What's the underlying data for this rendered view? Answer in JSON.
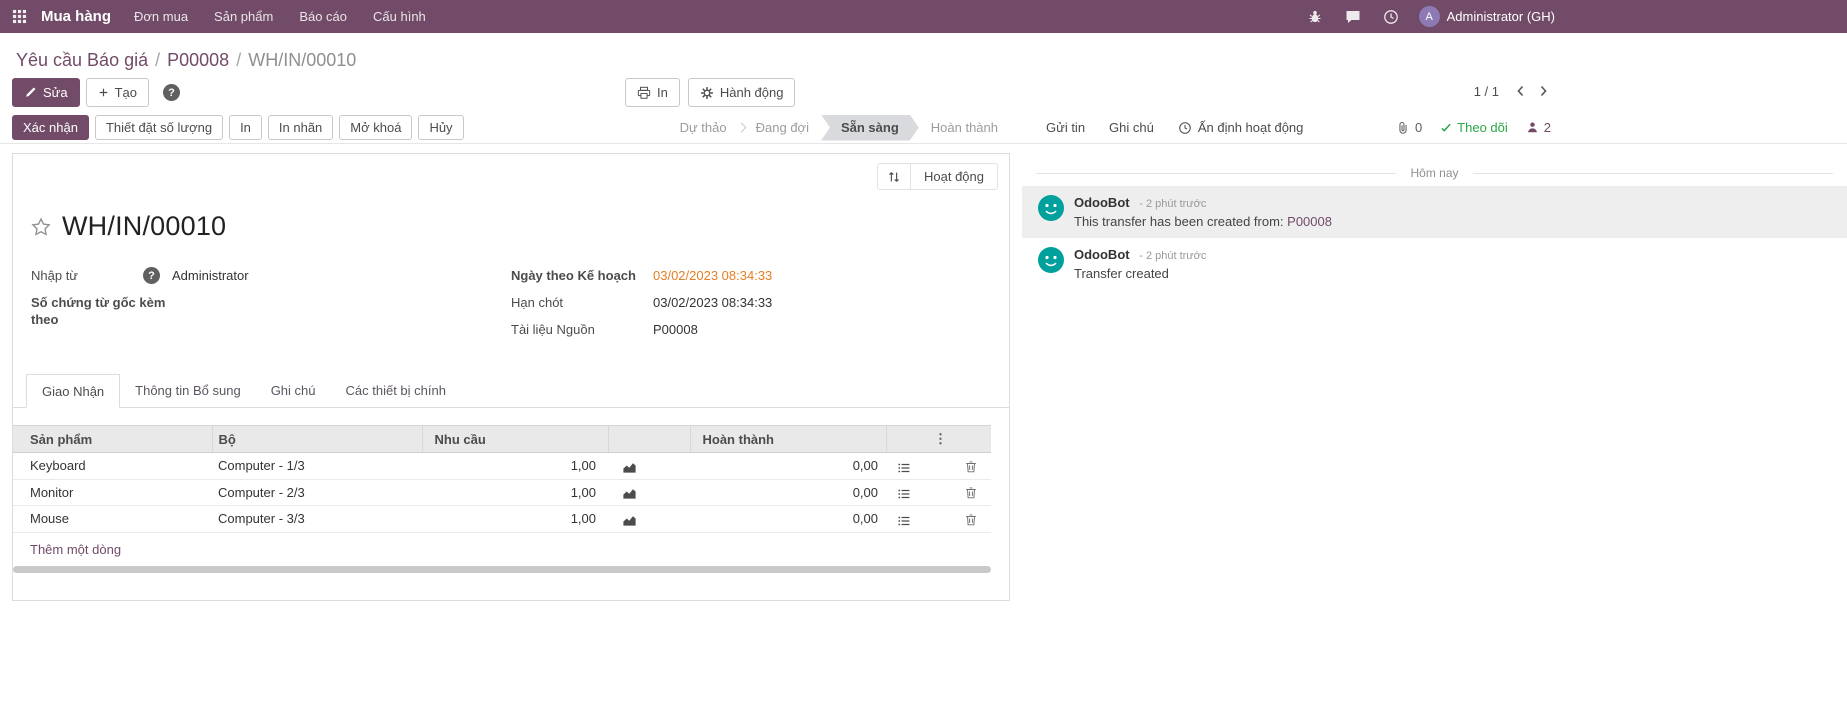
{
  "navbar": {
    "app_name": "Mua hàng",
    "menus": [
      "Đơn mua",
      "Sản phẩm",
      "Báo cáo",
      "Cấu hình"
    ],
    "user": "Administrator (GH)",
    "avatar_initial": "A"
  },
  "breadcrumb": {
    "items": [
      "Yêu cầu Báo giá",
      "P00008"
    ],
    "current": "WH/IN/00010",
    "separator": "/"
  },
  "control_panel": {
    "edit": "Sửa",
    "create": "Tạo",
    "print": "In",
    "action": "Hành động",
    "pager": "1 / 1"
  },
  "statusbar": {
    "buttons": [
      "Xác nhận",
      "Thiết đặt số lượng",
      "In",
      "In nhãn",
      "Mở khoá",
      "Hủy"
    ],
    "steps": [
      {
        "label": "Dự thảo",
        "active": false
      },
      {
        "label": "Đang đợi",
        "active": false
      },
      {
        "label": "Sẵn sàng",
        "active": true
      },
      {
        "label": "Hoàn thành",
        "active": false
      }
    ]
  },
  "sheet": {
    "activity_button": "Hoạt động",
    "title": "WH/IN/00010",
    "fields": {
      "left": [
        {
          "label": "Nhập từ",
          "value": "Administrator"
        },
        {
          "label": "Số chứng từ gốc kèm theo",
          "value": ""
        }
      ],
      "right": [
        {
          "label": "Ngày theo Kế hoạch",
          "value": "03/02/2023 08:34:33"
        },
        {
          "label": "Hạn chót",
          "value": "03/02/2023 08:34:33"
        },
        {
          "label": "Tài liệu Nguồn",
          "value": "P00008"
        }
      ]
    },
    "tabs": [
      "Giao Nhận",
      "Thông tin Bổ sung",
      "Ghi chú",
      "Các thiết bị chính"
    ],
    "active_tab": "Giao Nhận",
    "table": {
      "headers": [
        "Sản phẩm",
        "Bộ",
        "Nhu cầu",
        "Hoàn thành"
      ],
      "rows": [
        {
          "product": "Keyboard",
          "set": "Computer - 1/3",
          "demand": "1,00",
          "done": "0,00"
        },
        {
          "product": "Monitor",
          "set": "Computer - 2/3",
          "demand": "1,00",
          "done": "0,00"
        },
        {
          "product": "Mouse",
          "set": "Computer - 3/3",
          "demand": "1,00",
          "done": "0,00"
        }
      ],
      "add_line": "Thêm một dòng"
    }
  },
  "chatter": {
    "buttons": [
      "Gửi tin",
      "Ghi chú",
      "Ấn định hoạt động"
    ],
    "attachments_count": "0",
    "follow": "Theo dõi",
    "followers_count": "2",
    "day_divider": "Hôm nay",
    "messages": [
      {
        "author": "OdooBot",
        "time": "- 2 phút trước",
        "body_prefix": "This transfer has been created from: ",
        "body_link": "P00008"
      },
      {
        "author": "OdooBot",
        "time": "- 2 phút trước",
        "body_prefix": "Transfer created",
        "body_link": ""
      }
    ]
  },
  "icons": {
    "apps-menu-icon": "▦",
    "bug-icon": "bug",
    "chat-bubble-icon": "speech-bubble",
    "clock-icon": "clock",
    "pencil-icon": "pencil",
    "plus-icon": "+",
    "help-icon": "?",
    "printer-icon": "printer",
    "gear-icon": "gear",
    "chevron-left-icon": "‹",
    "chevron-right-icon": "›",
    "sort-icon": "⇅",
    "star-icon": "☆",
    "paperclip-icon": "paperclip",
    "check-icon": "✓",
    "person-icon": "person",
    "forecast-chart-icon": "area-chart",
    "detailed-operations-icon": "list",
    "trash-icon": "trash",
    "options-icon": "⋮",
    "odoobot-avatar": "robot-face"
  },
  "colors": {
    "primary": "#714B67",
    "statusbar_active_bg": "#d8dadd",
    "date_highlight": "#e67e22",
    "follow_green": "#28a745",
    "odoobot_teal": "#00A09D",
    "link": "#714B67"
  }
}
